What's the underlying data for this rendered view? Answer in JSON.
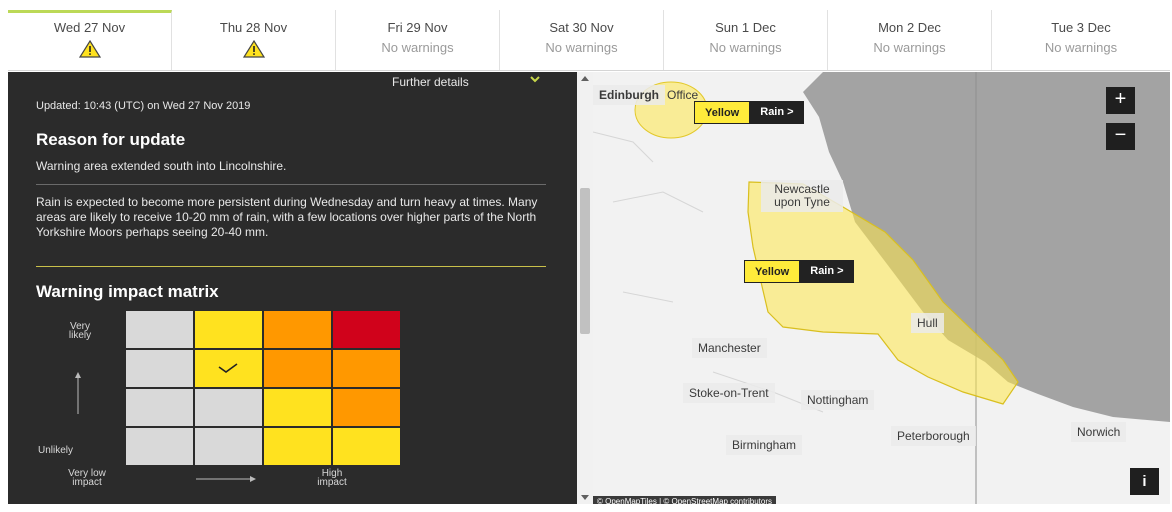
{
  "tabs": [
    {
      "date": "Wed 27 Nov",
      "status": "warning",
      "sub": ""
    },
    {
      "date": "Thu 28 Nov",
      "status": "warning",
      "sub": ""
    },
    {
      "date": "Fri 29 Nov",
      "status": "none",
      "sub": "No warnings"
    },
    {
      "date": "Sat 30 Nov",
      "status": "none",
      "sub": "No warnings"
    },
    {
      "date": "Sun 1 Dec",
      "status": "none",
      "sub": "No warnings"
    },
    {
      "date": "Mon 2 Dec",
      "status": "none",
      "sub": "No warnings"
    },
    {
      "date": "Tue 3 Dec",
      "status": "none",
      "sub": "No warnings"
    }
  ],
  "panel": {
    "further_details": "Further details",
    "updated": "Updated: 10:43 (UTC) on Wed 27 Nov 2019",
    "reason_heading": "Reason for update",
    "reason_text": "Warning area extended south into Lincolnshire.",
    "description": "Rain is expected to become more persistent during Wednesday and turn heavy at times. Many areas are likely to receive 10-20 mm of rain, with a few locations over higher parts of the North Yorkshire Moors perhaps seeing 20-40 mm.",
    "matrix_heading": "Warning impact matrix",
    "matrix_labels": {
      "very_likely": "Very likely",
      "unlikely": "Unlikely",
      "very_low_impact": "Very low impact",
      "high_impact": "High impact"
    },
    "matrix_colors": {
      "grey": "#d9d9d9",
      "yellow": "#ffe21f",
      "amber": "#ff9800",
      "red": "#d0021b"
    },
    "matrix_rows": [
      [
        "grey",
        "yellow",
        "amber",
        "red"
      ],
      [
        "grey",
        "yellow",
        "amber",
        "amber"
      ],
      [
        "grey",
        "grey",
        "yellow",
        "amber"
      ],
      [
        "grey",
        "grey",
        "yellow",
        "yellow"
      ]
    ],
    "matrix_selected": {
      "row": 1,
      "col": 1
    }
  },
  "map": {
    "places": {
      "edinburgh": "Edinburgh",
      "office": "Office",
      "newcastle": "Newcastle upon Tyne",
      "hull": "Hull",
      "manchester": "Manchester",
      "stoke": "Stoke-on-Trent",
      "nottingham": "Nottingham",
      "peterborough": "Peterborough",
      "norwich": "Norwich",
      "birmingham": "Birmingham"
    },
    "badges": [
      {
        "level": "Yellow",
        "type": "Rain >"
      },
      {
        "level": "Yellow",
        "type": "Rain >"
      }
    ],
    "zoom_in": "+",
    "zoom_out": "−",
    "info": "i",
    "attribution": "© OpenMapTiles | © OpenStreetMap contributors"
  }
}
